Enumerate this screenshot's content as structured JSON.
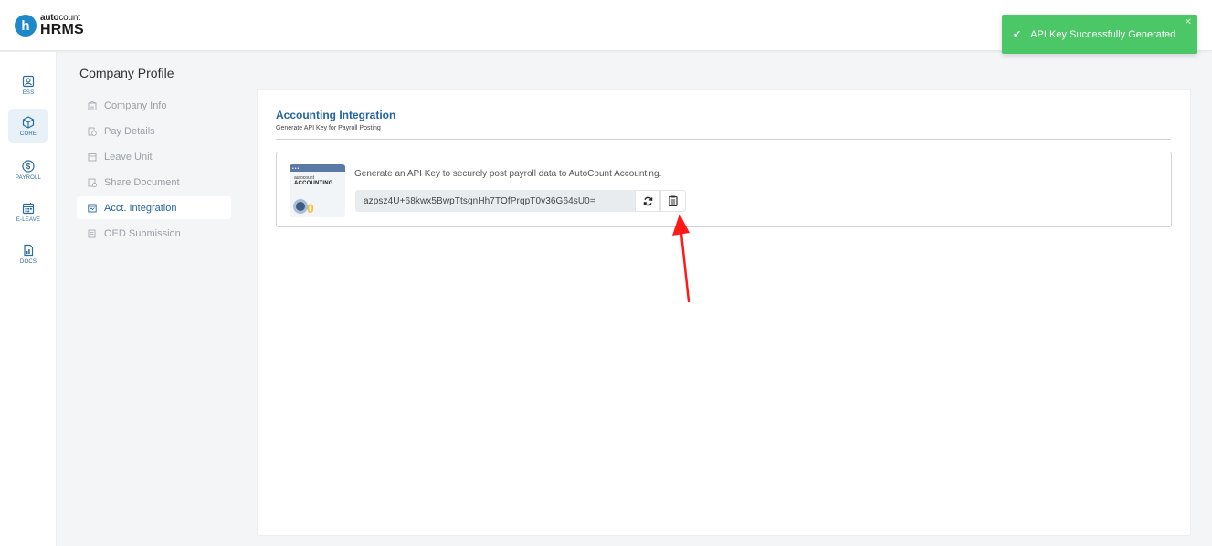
{
  "header": {
    "logo_letter": "h",
    "logo_brand_bold": "auto",
    "logo_brand_light": "count",
    "logo_product": "HRMS"
  },
  "toast": {
    "message": "API Key Successfully Generated",
    "icon": "check-icon",
    "close_icon": "close-icon",
    "color": "#4cc768"
  },
  "rail": {
    "items": [
      {
        "label": "ESS",
        "icon": "ess-icon",
        "active": false
      },
      {
        "label": "CORE",
        "icon": "core-icon",
        "active": true
      },
      {
        "label": "PAYROLL",
        "icon": "payroll-icon",
        "active": false
      },
      {
        "label": "E-LEAVE",
        "icon": "calendar-icon",
        "active": false
      },
      {
        "label": "DOCS",
        "icon": "docs-icon",
        "active": false
      }
    ]
  },
  "page": {
    "title": "Company Profile"
  },
  "submenu": {
    "items": [
      {
        "label": "Company Info",
        "icon": "building-icon",
        "active": false
      },
      {
        "label": "Pay Details",
        "icon": "pay-icon",
        "active": false
      },
      {
        "label": "Leave Unit",
        "icon": "calendar-icon",
        "active": false
      },
      {
        "label": "Share Document",
        "icon": "share-doc-icon",
        "active": false
      },
      {
        "label": "Acct. Integration",
        "icon": "integration-icon",
        "active": true
      },
      {
        "label": "OED Submission",
        "icon": "submission-icon",
        "active": false
      }
    ]
  },
  "card": {
    "title": "Accounting Integration",
    "subtitle": "Generate API Key for Payroll Posting",
    "integration": {
      "logo_brand": "autocount",
      "logo_word": "ACCOUNTING",
      "description": "Generate an API Key to securely post payroll data to AutoCount Accounting.",
      "api_key": "azpsz4U+68kwx5BwpTtsgnHh7TOfPrqpT0v36G64sU0=",
      "regenerate_icon": "refresh-icon",
      "copy_icon": "copy-icon"
    }
  },
  "colors": {
    "accent": "#2364a0",
    "annotation": "#ff1a1a"
  }
}
